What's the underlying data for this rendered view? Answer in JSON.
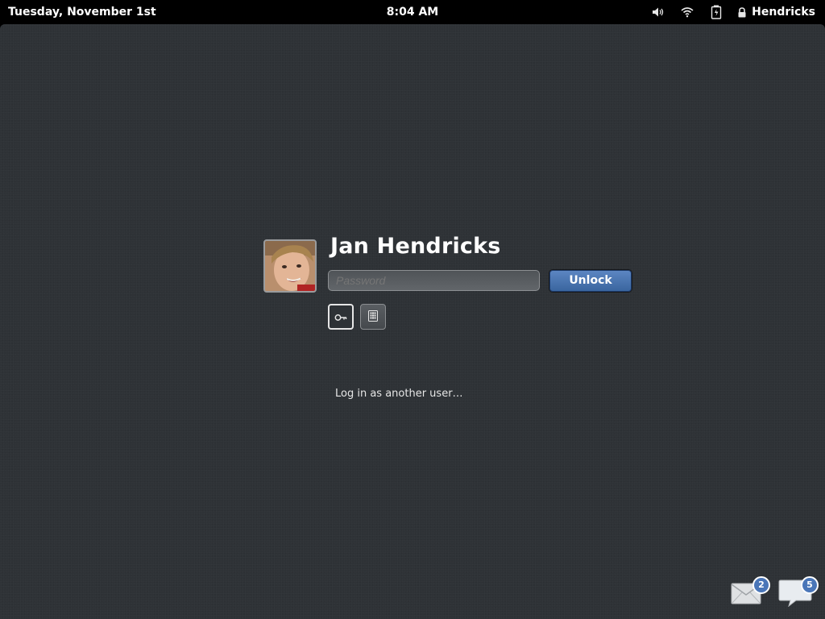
{
  "topbar": {
    "date": "Tuesday, November 1st",
    "time": "8:04 AM",
    "user": "Hendricks",
    "indicators": [
      "volume-icon",
      "wifi-icon",
      "battery-icon",
      "lock-icon"
    ]
  },
  "login": {
    "display_name": "Jan Hendricks",
    "password_placeholder": "Password",
    "unlock_label": "Unlock",
    "other_user_label": "Log in as another user…"
  },
  "auth_methods": [
    "key-icon",
    "keypad-icon"
  ],
  "tray": {
    "mail_count": "2",
    "chat_count": "5"
  },
  "colors": {
    "background": "#2e3236",
    "topbar": "#000000",
    "accent": "#4a76b8"
  }
}
